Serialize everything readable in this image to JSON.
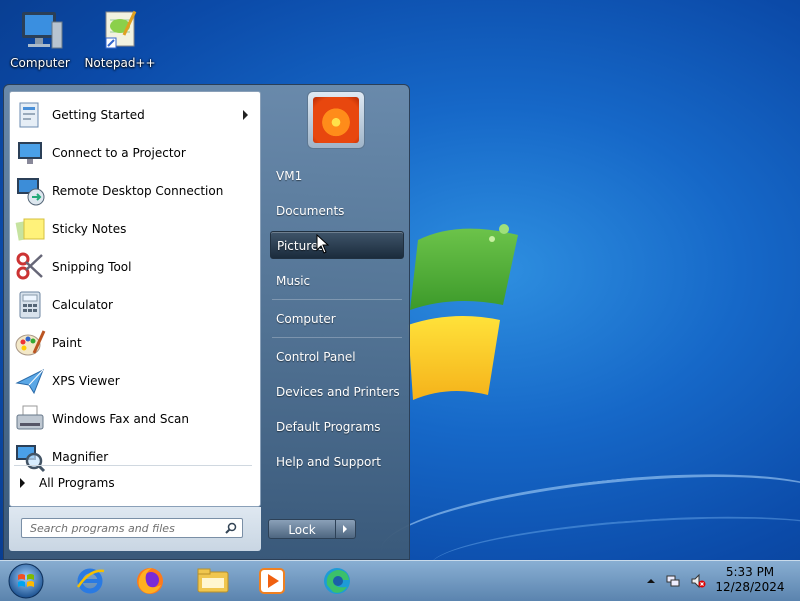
{
  "desktop": {
    "icons": [
      {
        "label": "Computer"
      },
      {
        "label": "Notepad++"
      }
    ]
  },
  "start_menu": {
    "programs": [
      {
        "label": "Getting Started",
        "has_submenu": true
      },
      {
        "label": "Connect to a Projector"
      },
      {
        "label": "Remote Desktop Connection"
      },
      {
        "label": "Sticky Notes"
      },
      {
        "label": "Snipping Tool"
      },
      {
        "label": "Calculator"
      },
      {
        "label": "Paint"
      },
      {
        "label": "XPS Viewer"
      },
      {
        "label": "Windows Fax and Scan"
      },
      {
        "label": "Magnifier"
      }
    ],
    "all_programs": "All Programs",
    "search_placeholder": "Search programs and files",
    "right_items": [
      {
        "label": "VM1"
      },
      {
        "label": "Documents"
      },
      {
        "label": "Pictures",
        "hovered": true
      },
      {
        "label": "Music"
      },
      {
        "label": "Computer"
      },
      {
        "label": "Control Panel"
      },
      {
        "label": "Devices and Printers"
      },
      {
        "label": "Default Programs"
      },
      {
        "label": "Help and Support"
      }
    ],
    "lock_label": "Lock"
  },
  "taskbar": {
    "pinned": [
      "start-orb-icon",
      "internet-explorer-icon",
      "firefox-icon",
      "file-explorer-icon",
      "media-player-icon",
      "edge-icon"
    ],
    "clock": {
      "time": "5:33 PM",
      "date": "12/28/2024"
    }
  }
}
